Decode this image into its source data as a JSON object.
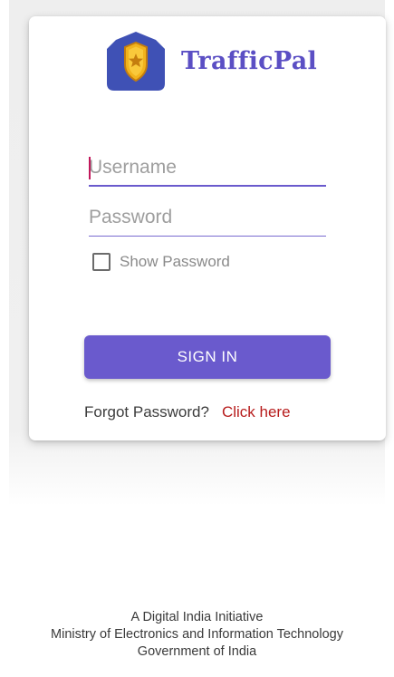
{
  "app": {
    "name": "TrafficPal",
    "logo_icon": "police-badge-star-icon",
    "brand_color": "#5b4fc4"
  },
  "login": {
    "username_placeholder": "Username",
    "password_placeholder": "Password",
    "show_password_label": "Show Password",
    "show_password_checked": false,
    "sign_in_label": "SIGN IN",
    "forgot_text": "Forgot Password?",
    "click_here_label": "Click here"
  },
  "colors": {
    "accent": "#6a5acd",
    "link": "#b71c1c"
  },
  "footer": {
    "line1": "A Digital India Initiative",
    "line2": "Ministry of Electronics and Information Technology",
    "line3": "Government of India"
  }
}
